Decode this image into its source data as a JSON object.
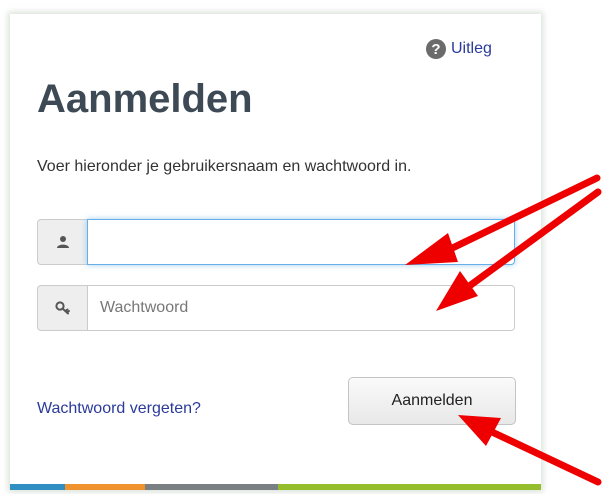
{
  "header": {
    "help_icon_glyph": "?",
    "help_label": "Uitleg"
  },
  "title": "Aanmelden",
  "instructions": "Voer hieronder je gebruikersnaam en wachtwoord in.",
  "form": {
    "username": {
      "value": "",
      "placeholder": "",
      "icon": "user-icon"
    },
    "password": {
      "value": "",
      "placeholder": "Wachtwoord",
      "icon": "key-icon"
    },
    "forgot_label": "Wachtwoord vergeten?",
    "submit_label": "Aanmelden"
  },
  "colors": {
    "title": "#3d4a55",
    "link": "#2a3a9a",
    "annotation_arrow": "#ee0000",
    "bar_segments": [
      "#2f8fc2",
      "#f0922e",
      "#7a7f84",
      "#96be2c"
    ]
  },
  "annotations": {
    "arrow_count": 3,
    "arrow_targets": [
      "username-input",
      "password-input",
      "login-button"
    ]
  }
}
